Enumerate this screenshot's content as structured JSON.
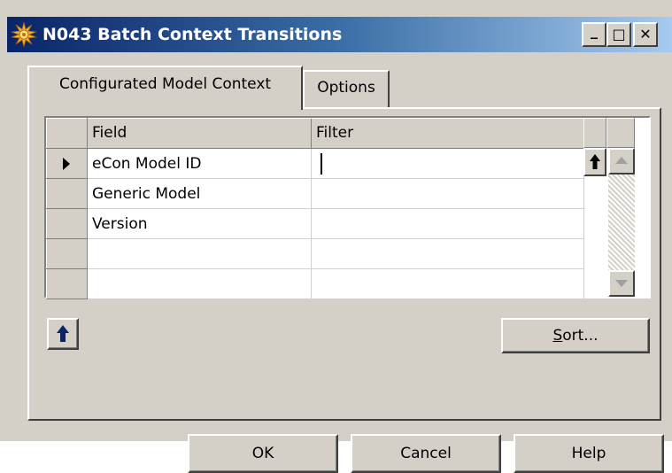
{
  "window": {
    "title": "N043 Batch Context Transitions",
    "controls": {
      "minimize": "_",
      "maximize": "□",
      "close": "✕"
    }
  },
  "tabs": [
    {
      "label": "Configurated Model Context",
      "active": true
    },
    {
      "label": "Options",
      "active": false
    }
  ],
  "grid": {
    "columns": [
      "Field",
      "Filter"
    ],
    "rows": [
      {
        "field": "eCon Model ID",
        "filter": "",
        "current": true
      },
      {
        "field": "Generic Model",
        "filter": ""
      },
      {
        "field": "Version",
        "filter": ""
      },
      {
        "field": "",
        "filter": ""
      },
      {
        "field": "",
        "filter": ""
      }
    ]
  },
  "buttons": {
    "sort_mnemonic": "S",
    "sort_rest": "ort...",
    "ok": "OK",
    "cancel": "Cancel",
    "help": "Help"
  },
  "icons": {
    "app": "gear-burst-icon",
    "move_up": "arrow-up-icon",
    "lookup": "arrow-up-icon"
  },
  "colors": {
    "title_gradient_start": "#0a246a",
    "title_gradient_end": "#a6caf0",
    "face": "#d4d0c8",
    "arrow_blue": "#0a246a"
  }
}
